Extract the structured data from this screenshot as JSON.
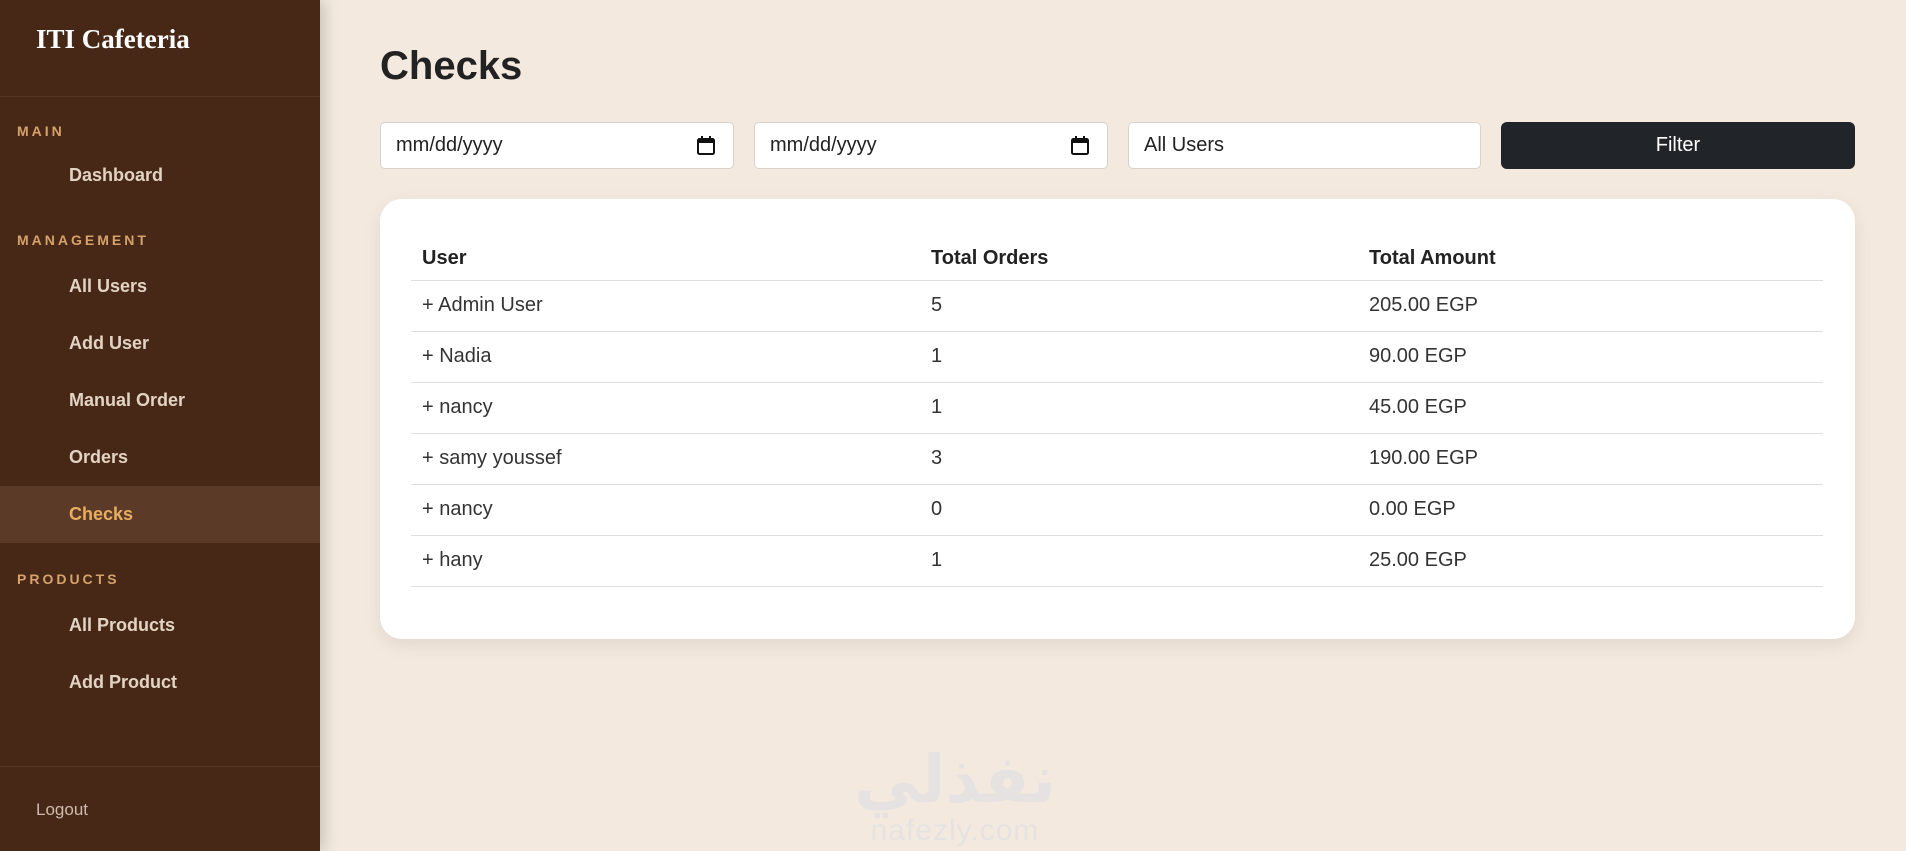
{
  "sidebar": {
    "brand": "ITI Cafeteria",
    "sections": [
      {
        "title": "MAIN",
        "items": [
          "Dashboard"
        ]
      },
      {
        "title": "MANAGEMENT",
        "items": [
          "All Users",
          "Add User",
          "Manual Order",
          "Orders",
          "Checks"
        ]
      },
      {
        "title": "PRODUCTS",
        "items": [
          "All Products",
          "Add Product"
        ]
      }
    ],
    "active_item": "Checks",
    "logout": "Logout"
  },
  "page": {
    "title": "Checks"
  },
  "filters": {
    "date_from_placeholder": "mm/dd/yyyy",
    "date_to_placeholder": "mm/dd/yyyy",
    "user_select_value": "All Users",
    "filter_button": "Filter"
  },
  "table": {
    "headers": [
      "User",
      "Total Orders",
      "Total Amount"
    ],
    "rows": [
      [
        "+ Admin User",
        "5",
        "205.00 EGP"
      ],
      [
        "+ Nadia",
        "1",
        "90.00 EGP"
      ],
      [
        "+ nancy",
        "1",
        "45.00 EGP"
      ],
      [
        "+ samy youssef",
        "3",
        "190.00 EGP"
      ],
      [
        "+ nancy",
        "0",
        "0.00 EGP"
      ],
      [
        "+ hany",
        "1",
        "25.00 EGP"
      ]
    ]
  },
  "watermark": {
    "arabic": "نفذلي",
    "latin": "nafezly.com"
  },
  "colors": {
    "sidebar": "#472817",
    "background": "#f3e9df",
    "accent": "#e9ad62",
    "button": "#212529"
  }
}
